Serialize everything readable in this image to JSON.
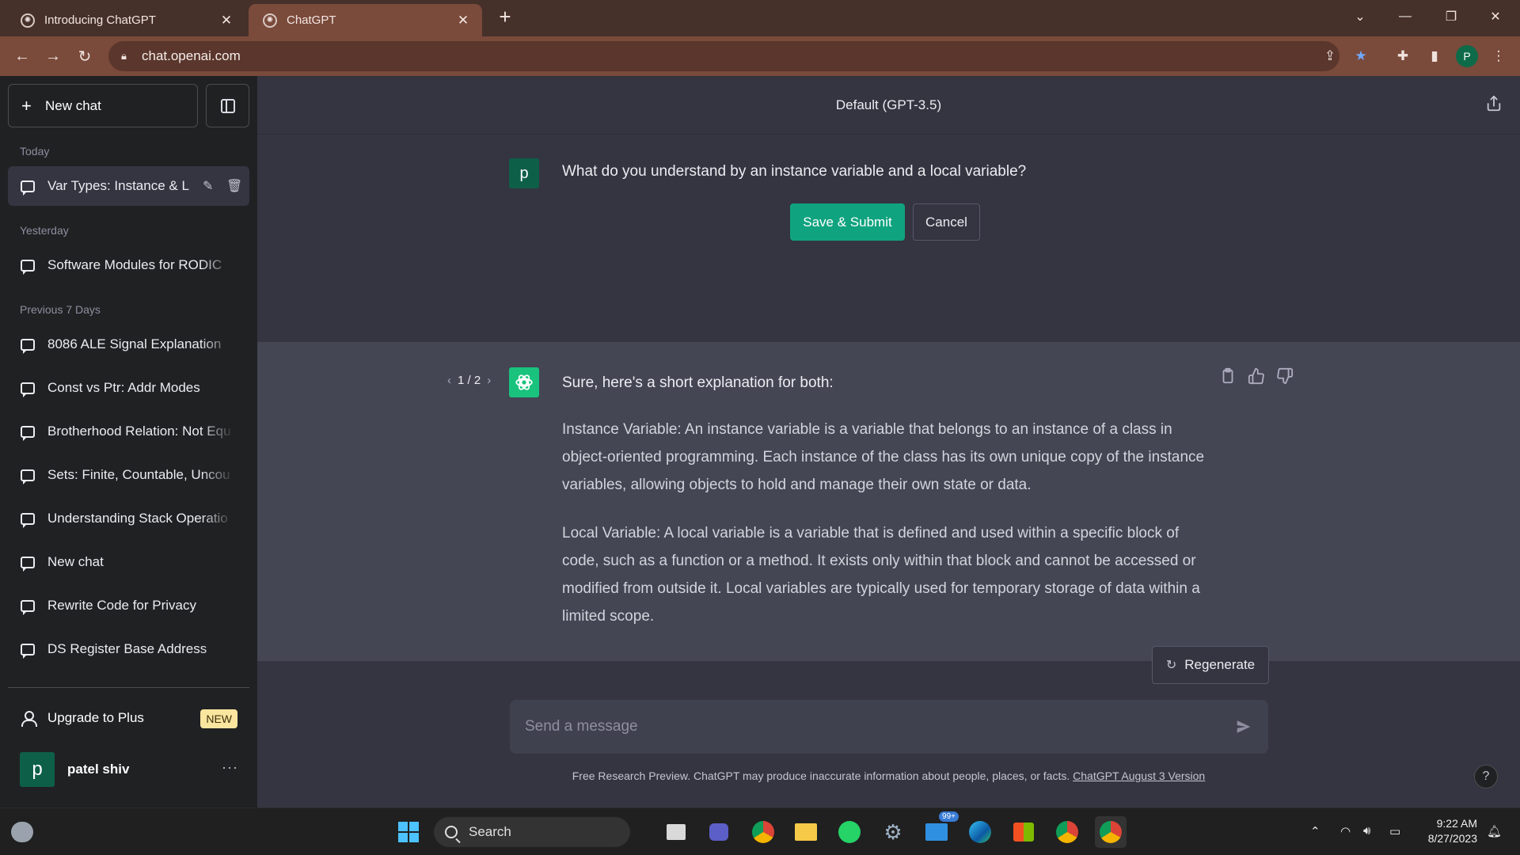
{
  "browser": {
    "tabs": [
      {
        "title": "Introducing ChatGPT",
        "active": false
      },
      {
        "title": "ChatGPT",
        "active": true
      }
    ],
    "url": "chat.openai.com",
    "profile_initial": "P"
  },
  "sidebar": {
    "new_chat_label": "New chat",
    "sections": {
      "today": "Today",
      "yesterday": "Yesterday",
      "previous": "Previous 7 Days"
    },
    "today_items": [
      "Var Types: Instance & L"
    ],
    "yesterday_items": [
      "Software Modules for RODIC"
    ],
    "previous_items": [
      "8086 ALE Signal Explanation",
      "Const vs Ptr: Addr Modes",
      "Brotherhood Relation: Not Equ",
      "Sets: Finite, Countable, Uncou",
      "Understanding Stack Operatio",
      "New chat",
      "Rewrite Code for Privacy",
      "DS Register Base Address"
    ],
    "upgrade_label": "Upgrade to Plus",
    "upgrade_badge": "NEW",
    "user_initial": "p",
    "user_name": "patel shiv"
  },
  "main": {
    "model_title": "Default (GPT-3.5)",
    "user_avatar_initial": "p",
    "user_message": "What do you understand by an instance variable and a local variable?",
    "save_label": "Save & Submit",
    "cancel_label": "Cancel",
    "pager": "1 / 2",
    "answer": {
      "intro": "Sure, here's a short explanation for both:",
      "p1": "Instance Variable: An instance variable is a variable that belongs to an instance of a class in object-oriented programming. Each instance of the class has its own unique copy of the instance variables, allowing objects to hold and manage their own state or data.",
      "p2": "Local Variable: A local variable is a variable that is defined and used within a specific block of code, such as a function or a method. It exists only within that block and cannot be accessed or modified from outside it. Local variables are typically used for temporary storage of data within a limited scope."
    },
    "regenerate_label": "Regenerate",
    "composer_placeholder": "Send a message",
    "disclaimer": "Free Research Preview. ChatGPT may produce inaccurate information about people, places, or facts.",
    "disclaimer_link": "ChatGPT August 3 Version",
    "help_label": "?"
  },
  "taskbar": {
    "search_label": "Search",
    "mail_badge": "99+",
    "time": "9:22 AM",
    "date": "8/27/2023"
  },
  "colors": {
    "accent_green": "#10a37f",
    "sidebar_bg": "#202123",
    "main_bg": "#343541",
    "assistant_bg": "#444654",
    "browser_frame": "#7a4a3b"
  }
}
